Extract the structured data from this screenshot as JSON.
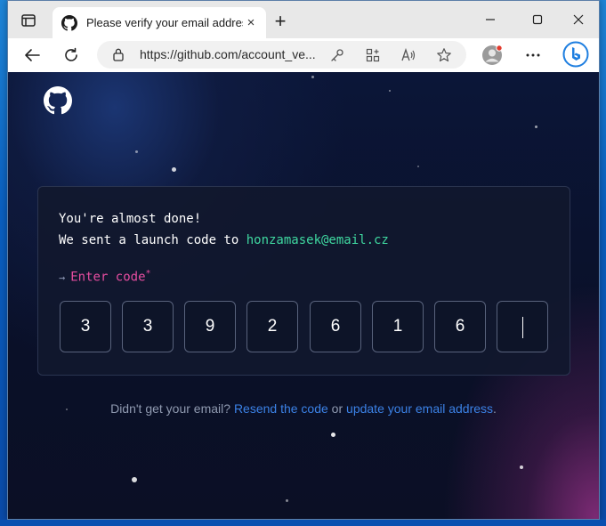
{
  "browser": {
    "tab_title": "Please verify your email address",
    "url": "https://github.com/account_ve...",
    "new_tab_label": "+",
    "tab_close_label": "×"
  },
  "card": {
    "line1": "You're almost done!",
    "line2_prefix": "We sent a launch code to ",
    "email": "honzamasek@email.cz",
    "prompt_arrow": "→",
    "prompt_label": "Enter code",
    "prompt_required": "*",
    "code_digits": [
      "3",
      "3",
      "9",
      "2",
      "6",
      "1",
      "6",
      ""
    ]
  },
  "footer": {
    "prefix": "Didn't get your email? ",
    "resend_link": "Resend the code",
    "middle": " or ",
    "update_link": "update your email address",
    "suffix": "."
  },
  "colors": {
    "email": "#3fd8a0",
    "prompt": "#e64da0",
    "link": "#3b82e6"
  }
}
